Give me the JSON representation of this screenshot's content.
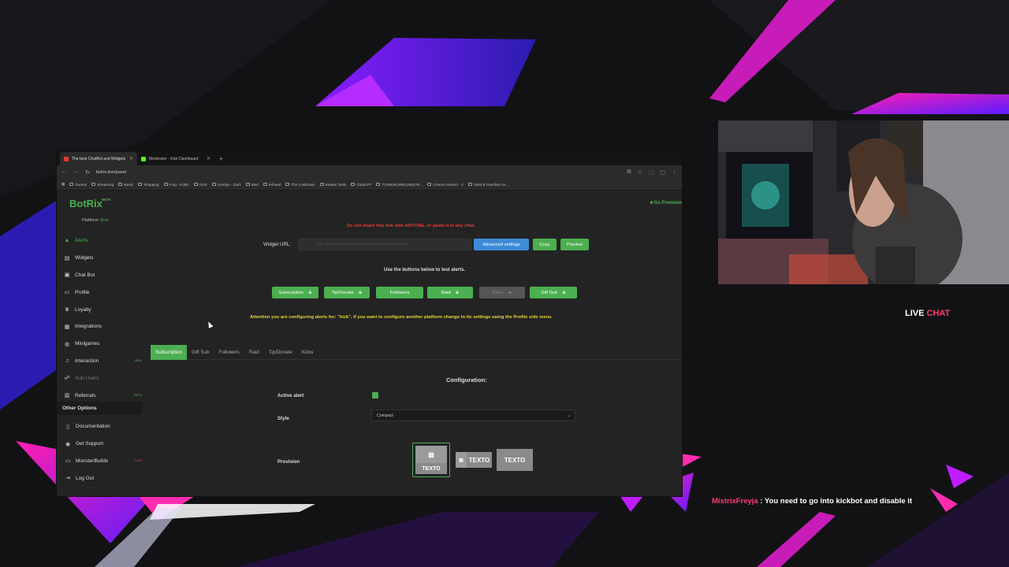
{
  "browser": {
    "tabs": [
      {
        "title": "The best ChatBot and Widgets",
        "favicon_color": "#e53935",
        "active": true
      },
      {
        "title": "Moderator - Kick Dashboard",
        "favicon_color": "#53fc18",
        "active": false
      }
    ],
    "url": "botrix.live/panel",
    "bookmarks": [
      "Games",
      "Streaming",
      "Music",
      "Shopping",
      "Forg - Kotlin",
      "GUS",
      "Goodyn - Zach",
      "Mod",
      "Ierhead",
      "The LostDrake",
      "Stream Tools",
      "ChatGPT",
      "TURBOKURBJUNSON...",
      "Cinema Stream - V",
      "1560 E Hamilton Av..."
    ]
  },
  "app": {
    "logo": "BotRix",
    "logo_badge": "BETA",
    "platform_label": "Platform:",
    "platform_value": "Kick",
    "premium": "Go Premium",
    "nav": [
      {
        "label": "Alerts",
        "icon": "warning-icon",
        "glyph": "▲",
        "active": true,
        "tag": ""
      },
      {
        "label": "Widgets",
        "icon": "widgets-icon",
        "glyph": "▤",
        "tag": ""
      },
      {
        "label": "Chat Bot",
        "icon": "chat-icon",
        "glyph": "▣",
        "tag": ""
      },
      {
        "label": "Profile",
        "icon": "profile-icon",
        "glyph": "▭",
        "tag": ""
      },
      {
        "label": "Loyalty",
        "icon": "trophy-icon",
        "glyph": "♛",
        "tag": ""
      },
      {
        "label": "Integrations",
        "icon": "integrations-icon",
        "glyph": "▦",
        "tag": ""
      },
      {
        "label": "Minigames",
        "icon": "gamepad-icon",
        "glyph": "◍",
        "tag": ""
      },
      {
        "label": "Interaction",
        "icon": "music-icon",
        "glyph": "♫",
        "tag": "NEW"
      },
      {
        "label": "Sub-Users",
        "icon": "users-icon",
        "glyph": "☍",
        "disabled": true,
        "tag": ""
      },
      {
        "label": "Referrals",
        "icon": "referrals-icon",
        "glyph": "▥",
        "tag": "BETA"
      }
    ],
    "other_heading": "Other Options",
    "other": [
      {
        "label": "Documentation",
        "icon": "book-icon",
        "glyph": "▯",
        "tag": ""
      },
      {
        "label": "Get Support",
        "icon": "support-icon",
        "glyph": "◉",
        "tag": ""
      },
      {
        "label": "MonsterBuilds",
        "icon": "monitor-icon",
        "glyph": "▭",
        "tag": "NEW"
      },
      {
        "label": "Log Out",
        "icon": "logout-icon",
        "glyph": "⇥",
        "tag": ""
      }
    ],
    "warning": "Do not share this link with ANYONE, or paste it in any chat.",
    "widget_url_label": "Widget URL:",
    "widget_url_value": "https://botrix.live/alerts?bid=xxxxxxxxxxxxxxxxxxxxxxxx",
    "buttons": {
      "advanced": "Advanced settings",
      "copy": "Copy",
      "preview": "Preview"
    },
    "test_note": "Use the buttons below to test alerts.",
    "test_buttons": [
      {
        "label": "Subscription",
        "plus": "+"
      },
      {
        "label": "Tip/Donate",
        "plus": "+"
      },
      {
        "label": "Followers",
        "plus": ""
      },
      {
        "label": "Raid",
        "plus": "+"
      },
      {
        "label": "Kicks",
        "plus": "+"
      },
      {
        "label": "Gift Sub",
        "plus": "+"
      }
    ],
    "attention": "Attention you are configuring alerts for: \"kick\", if you want to configure another platform change to its settings using the Profile side menu",
    "config_tabs": [
      "Subscription",
      "Gift Sub",
      "Followers",
      "Raid",
      "Tip/Donate",
      "Kicks"
    ],
    "config_title": "Configuration:",
    "active_alert_label": "Active alert",
    "style_label": "Style",
    "style_value": "Compact",
    "provision_label": "Provision",
    "provision_text": "TEXTO"
  },
  "stream": {
    "live_label": "LIVE",
    "chat_label": "CHAT",
    "chat_user": "MistrixFreyja",
    "chat_message": " : You need to go into kickbot and disable it",
    "accent_pink": "#ff3d6e",
    "accent_purple": "#7b2cff"
  }
}
